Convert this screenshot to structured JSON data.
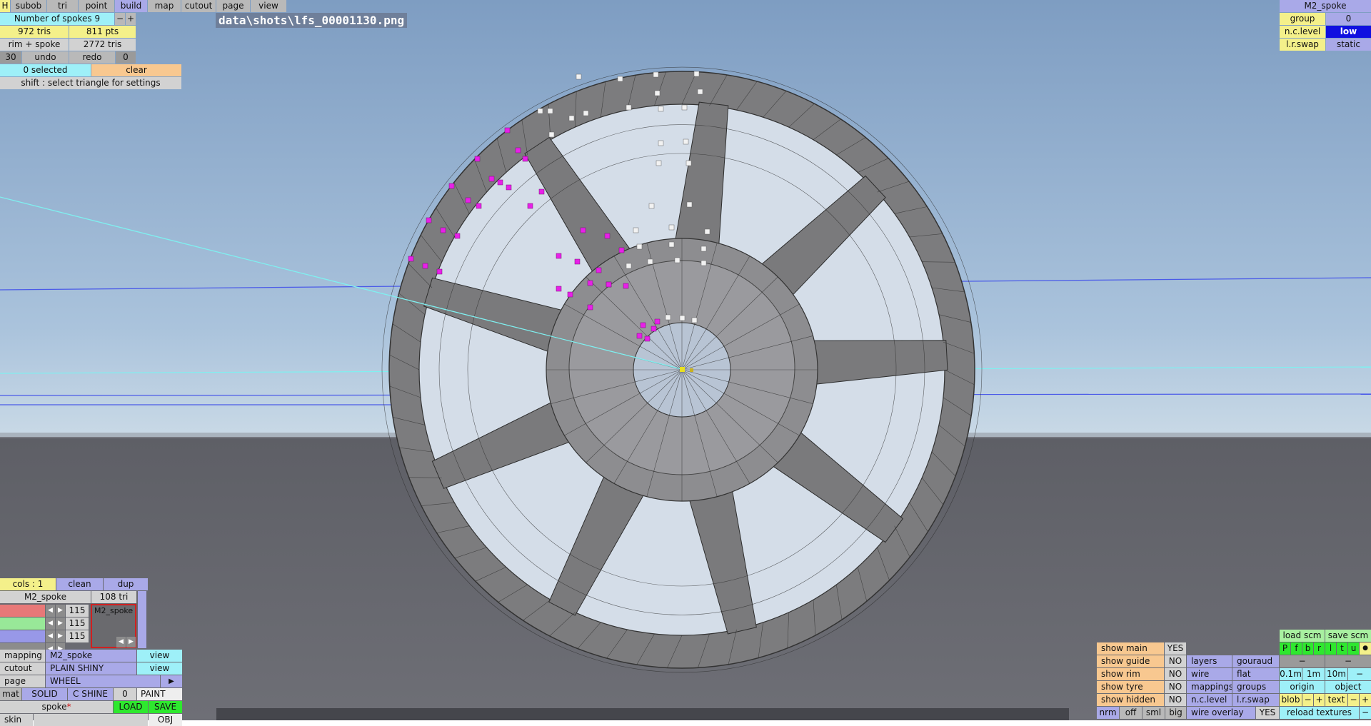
{
  "file_path": "data\\shots\\lfs_00001130.png",
  "top_menu": [
    "H",
    "subob",
    "tri",
    "point",
    "build",
    "map",
    "cutout",
    "page",
    "view"
  ],
  "spokes": {
    "label": "Number of spokes 9",
    "minus": "−",
    "plus": "+"
  },
  "stats": {
    "tris": "972 tris",
    "pts": "811 pts",
    "rim_spoke": "rim + spoke",
    "rim_spoke_tris": "2772 tris"
  },
  "history": {
    "count": "30",
    "undo": "undo",
    "redo": "redo",
    "redo_count": "0"
  },
  "selection": {
    "selected": "0 selected",
    "clear": "clear",
    "hint": "shift : select triangle for settings"
  },
  "top_right": {
    "object_name": "M2_spoke",
    "group_label": "group",
    "group_value": "0",
    "nc_level_label": "n.c.level",
    "nc_level_value": "low",
    "lr_swap_label": "l.r.swap",
    "lr_swap_value": "static"
  },
  "bottom_left": {
    "cols": "cols : 1",
    "clean": "clean",
    "dup": "dup",
    "name": "M2_spoke",
    "tri_count": "108 tri",
    "color_values": [
      "115",
      "115",
      "115"
    ],
    "preview_label": "M2_spoke",
    "mapping_label": "mapping",
    "mapping_value": "M2_spoke",
    "mapping_view": "view",
    "cutout_label": "cutout",
    "cutout_value": "PLAIN SHINY",
    "cutout_view": "view",
    "page_label": "page",
    "page_value": "WHEEL",
    "page_arrow": "▶",
    "mat_label": "mat",
    "mat_solid": "SOLID",
    "mat_shine": "C SHINE",
    "mat_value": "0",
    "mat_paint": "PAINT",
    "file_name": "spoke",
    "file_marker": "*",
    "load": "LOAD",
    "save": "SAVE",
    "skin_label": "skin",
    "obj": "OBJ"
  },
  "bottom_right": {
    "load_scm": "load scm",
    "save_scm": "save scm",
    "scm_buttons": [
      "P",
      "f",
      "b",
      "r",
      "l",
      "t",
      "u",
      "●"
    ],
    "dashes": [
      "−",
      "−"
    ],
    "rows": [
      {
        "label": "show main",
        "value": "YES"
      },
      {
        "label": "show guide",
        "value": "NO"
      },
      {
        "label": "show rim",
        "value": "NO"
      },
      {
        "label": "show tyre",
        "value": "NO"
      },
      {
        "label": "show hidden",
        "value": "NO"
      }
    ],
    "col3": [
      "layers",
      "wire",
      "mappings",
      "n.c.level"
    ],
    "col4": [
      "gouraud",
      "flat",
      "groups",
      "l.r.swap"
    ],
    "scale": [
      "0.1m",
      "1m",
      "10m",
      "−"
    ],
    "origin": "origin",
    "object": "object",
    "blob": "blob",
    "blob_minus": "−",
    "blob_plus": "+",
    "text": "text",
    "text_minus": "−",
    "text_plus": "+",
    "sizes": [
      "nrm",
      "off",
      "sml",
      "big"
    ],
    "wire_overlay": "wire overlay",
    "wire_overlay_value": "YES",
    "reload_textures": "reload textures",
    "reload_minus": "−"
  }
}
